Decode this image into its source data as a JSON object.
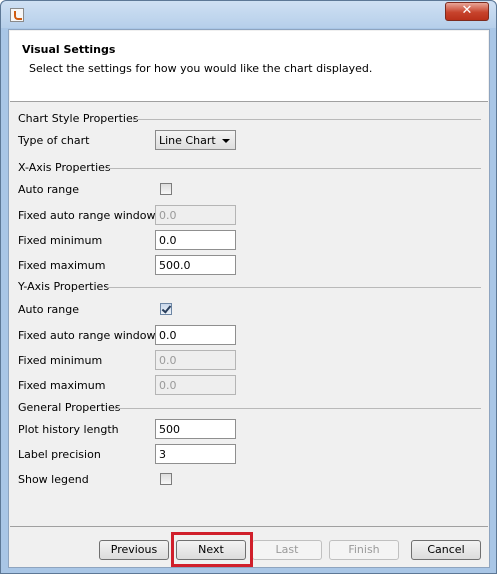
{
  "window": {
    "close_glyph": "✕"
  },
  "header": {
    "title": "Visual Settings",
    "description": "Select the settings for how you would like the chart displayed."
  },
  "chart_style": {
    "title": "Chart Style Properties",
    "type_label": "Type of chart",
    "type_value": "Line Chart"
  },
  "x_axis": {
    "title": "X-Axis Properties",
    "auto_range_label": "Auto range",
    "auto_range_checked": false,
    "window_label": "Fixed auto range window",
    "window_value": "0.0",
    "min_label": "Fixed minimum",
    "min_value": "0.0",
    "max_label": "Fixed maximum",
    "max_value": "500.0"
  },
  "y_axis": {
    "title": "Y-Axis Properties",
    "auto_range_label": "Auto range",
    "auto_range_checked": true,
    "window_label": "Fixed auto range window",
    "window_value": "0.0",
    "min_label": "Fixed minimum",
    "min_value": "0.0",
    "max_label": "Fixed maximum",
    "max_value": "0.0"
  },
  "general": {
    "title": "General Properties",
    "history_label": "Plot history length",
    "history_value": "500",
    "precision_label": "Label precision",
    "precision_value": "3",
    "legend_label": "Show legend",
    "legend_checked": false
  },
  "buttons": {
    "previous": "Previous",
    "next": "Next",
    "last": "Last",
    "finish": "Finish",
    "cancel": "Cancel"
  },
  "colors": {
    "highlight": "#d01f2b",
    "title_bar": "#b6cfea",
    "close": "#c7432c"
  }
}
